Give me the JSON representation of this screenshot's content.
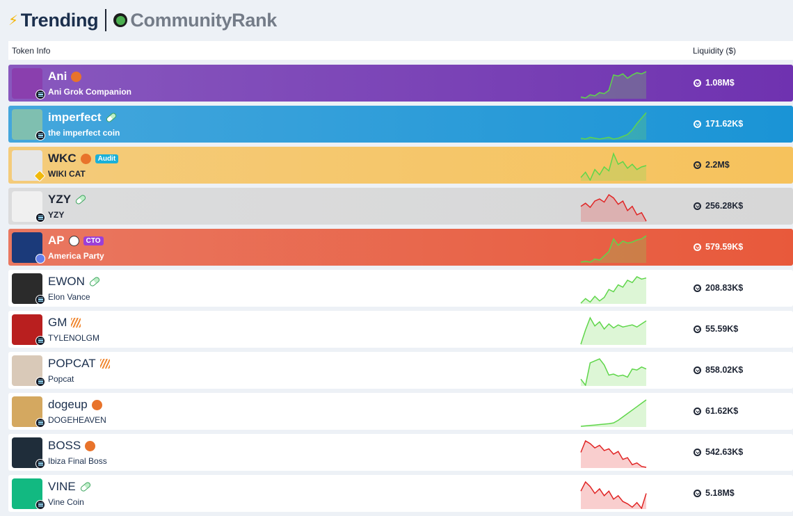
{
  "header": {
    "tabs": [
      {
        "label": "Trending",
        "icon": "lightning-icon",
        "active": true
      },
      {
        "label": "CommunityRank",
        "icon": "leaf-logo-icon",
        "active": false
      }
    ]
  },
  "table": {
    "columns": {
      "token_info": "Token Info",
      "liquidity": "Liquidity ($)"
    }
  },
  "tokens": [
    {
      "symbol": "Ani",
      "name": "Ani Grok Companion",
      "liquidity": "1.08M$",
      "chain": "solana",
      "background": "#6f32b0",
      "text_color": "#ffffff",
      "trend": "up",
      "badge": "",
      "tag_icon": "emoji-icon",
      "sparkline": [
        10,
        9,
        12,
        11,
        14,
        13,
        16,
        30,
        29,
        31,
        27,
        30,
        32,
        31,
        33
      ]
    },
    {
      "symbol": "imperfect",
      "name": "the imperfect coin",
      "liquidity": "171.62K$",
      "chain": "solana",
      "background": "#1a94d6",
      "text_color": "#ffffff",
      "trend": "up",
      "badge": "",
      "tag_icon": "pill-icon",
      "sparkline": [
        6,
        5,
        7,
        6,
        5,
        6,
        7,
        5,
        6,
        8,
        10,
        15,
        22,
        28,
        34
      ]
    },
    {
      "symbol": "WKC",
      "name": "WIKI CAT",
      "liquidity": "2.2M$",
      "chain": "bnb",
      "background": "#f6c25c",
      "text_color": "#1d2433",
      "trend": "up",
      "badge": "Audit",
      "badge_color": "#1ab0d8",
      "tag_icon": "emoji-icon",
      "sparkline": [
        12,
        16,
        10,
        18,
        14,
        20,
        17,
        30,
        22,
        24,
        19,
        22,
        18,
        20,
        21
      ]
    },
    {
      "symbol": "YZY",
      "name": "YZY",
      "liquidity": "256.28K$",
      "chain": "solana",
      "background": "#d7d7d7",
      "text_color": "#1d2433",
      "trend": "down",
      "badge": "",
      "tag_icon": "pill-icon",
      "sparkline": [
        22,
        25,
        21,
        27,
        29,
        26,
        33,
        30,
        24,
        27,
        18,
        22,
        14,
        16,
        8
      ]
    },
    {
      "symbol": "AP",
      "name": "America Party",
      "liquidity": "579.59K$",
      "chain": "ethereum",
      "background": "#e8593b",
      "text_color": "#ffffff",
      "trend": "up",
      "badge": "CTO",
      "badge_color": "#9b3fd8",
      "tag_icon": "unicorn-icon",
      "sparkline": [
        6,
        7,
        6,
        9,
        8,
        12,
        16,
        28,
        22,
        26,
        24,
        25,
        27,
        28,
        31
      ]
    },
    {
      "symbol": "EWON",
      "name": "Elon Vance",
      "liquidity": "208.83K$",
      "chain": "solana",
      "background": "#ffffff",
      "text_color": "#1b2f4d",
      "trend": "up",
      "badge": "",
      "tag_icon": "pill-icon",
      "sparkline": [
        8,
        12,
        9,
        14,
        10,
        13,
        20,
        18,
        24,
        22,
        28,
        26,
        31,
        29,
        30
      ]
    },
    {
      "symbol": "GM",
      "name": "TYLENOLGM",
      "liquidity": "55.59K$",
      "chain": "solana",
      "background": "#ffffff",
      "text_color": "#1b2f4d",
      "trend": "up",
      "badge": "",
      "tag_icon": "flame-icon",
      "sparkline": [
        4,
        18,
        30,
        22,
        26,
        19,
        24,
        20,
        23,
        21,
        22,
        23,
        21,
        24,
        27
      ]
    },
    {
      "symbol": "POPCAT",
      "name": "Popcat",
      "liquidity": "858.02K$",
      "chain": "solana",
      "background": "#ffffff",
      "text_color": "#1b2f4d",
      "trend": "up",
      "badge": "",
      "tag_icon": "flame-icon",
      "sparkline": [
        10,
        4,
        26,
        28,
        30,
        24,
        14,
        15,
        13,
        14,
        12,
        20,
        19,
        22,
        20
      ]
    },
    {
      "symbol": "dogeup",
      "name": "DOGEHEAVEN",
      "liquidity": "61.62K$",
      "chain": "solana",
      "background": "#ffffff",
      "text_color": "#1b2f4d",
      "trend": "up",
      "badge": "",
      "tag_icon": "emoji-icon",
      "sparkline": [
        2,
        2.5,
        3,
        3.5,
        4,
        4.5,
        5,
        6,
        9,
        13,
        17,
        21,
        25,
        29,
        33
      ]
    },
    {
      "symbol": "BOSS",
      "name": "Ibiza Final Boss",
      "liquidity": "542.63K$",
      "chain": "solana",
      "background": "#ffffff",
      "text_color": "#1b2f4d",
      "trend": "down",
      "badge": "",
      "tag_icon": "emoji-icon",
      "sparkline": [
        20,
        33,
        30,
        25,
        28,
        22,
        24,
        18,
        21,
        12,
        14,
        6,
        8,
        4,
        3
      ]
    },
    {
      "symbol": "VINE",
      "name": "Vine Coin",
      "liquidity": "5.18M$",
      "chain": "solana",
      "background": "#ffffff",
      "text_color": "#1b2f4d",
      "trend": "down",
      "badge": "",
      "tag_icon": "pill-icon",
      "sparkline": [
        18,
        26,
        22,
        16,
        20,
        14,
        18,
        11,
        14,
        9,
        7,
        4,
        8,
        3,
        16
      ]
    }
  ]
}
